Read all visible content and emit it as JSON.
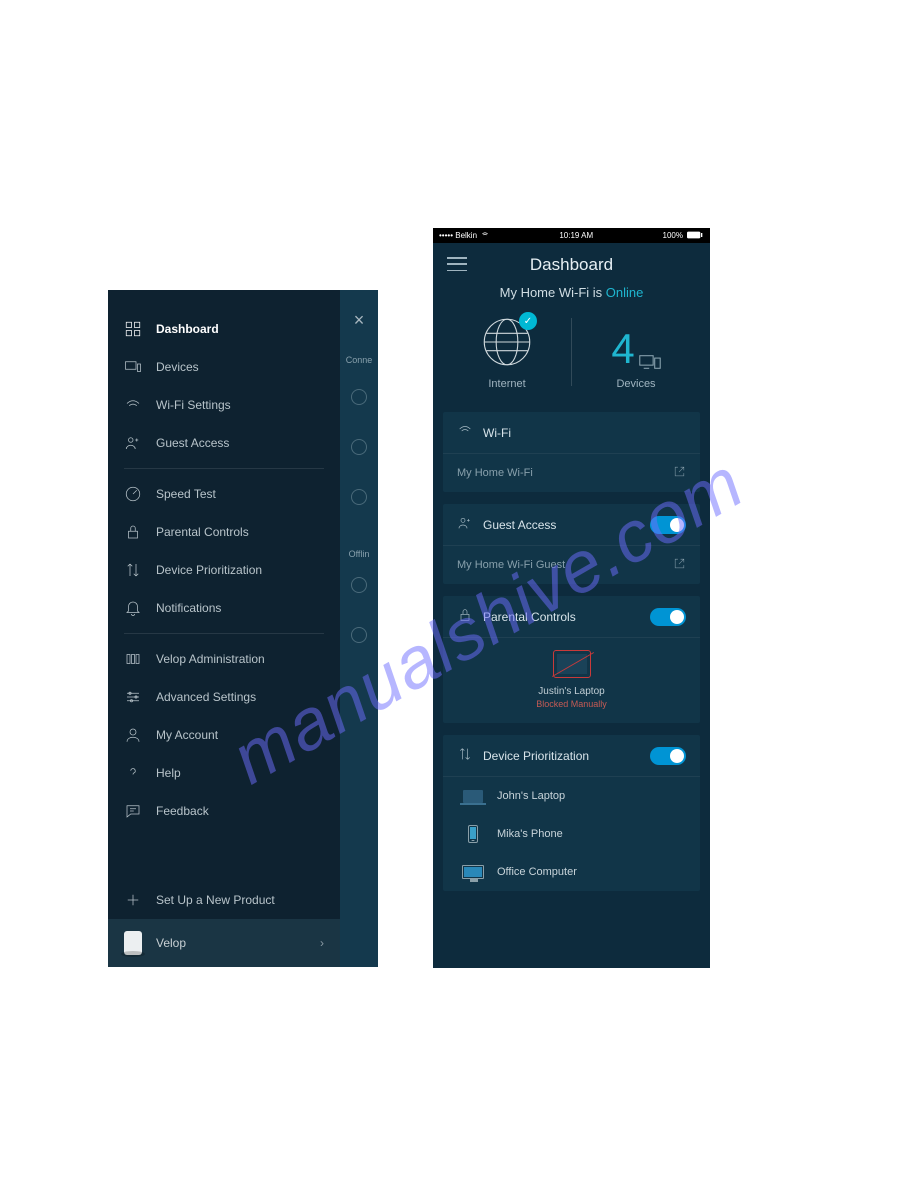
{
  "watermark": "manualshive.com",
  "left": {
    "menu": [
      {
        "label": "Dashboard",
        "active": true
      },
      {
        "label": "Devices"
      },
      {
        "label": "Wi-Fi Settings"
      },
      {
        "label": "Guest Access"
      },
      {
        "label": "Speed Test"
      },
      {
        "label": "Parental Controls"
      },
      {
        "label": "Device Prioritization"
      },
      {
        "label": "Notifications"
      },
      {
        "label": "Velop Administration"
      },
      {
        "label": "Advanced Settings"
      },
      {
        "label": "My Account"
      },
      {
        "label": "Help"
      },
      {
        "label": "Feedback"
      },
      {
        "label": "Set Up a New Product"
      }
    ],
    "footer": {
      "label": "Velop"
    },
    "sliver": {
      "close": "×",
      "connected_label": "Conne",
      "offline_label": "Offlin"
    }
  },
  "right": {
    "statusbar": {
      "carrier": "••••• Belkin",
      "time": "10:19 AM",
      "battery": "100%"
    },
    "header": {
      "title": "Dashboard"
    },
    "status_prefix": "My Home Wi-Fi is ",
    "status_value": "Online",
    "stats": {
      "internet": "Internet",
      "devices_count": "4",
      "devices_label": "Devices"
    },
    "wifi_card": {
      "title": "Wi-Fi",
      "ssid": "My Home Wi-Fi"
    },
    "guest_card": {
      "title": "Guest Access",
      "ssid": "My Home Wi-Fi Guest"
    },
    "parental_card": {
      "title": "Parental Controls",
      "blocked_name": "Justin's Laptop",
      "blocked_status": "Blocked Manually"
    },
    "priority_card": {
      "title": "Device Prioritization",
      "devices": [
        "John's Laptop",
        "Mika's Phone",
        "Office Computer"
      ]
    }
  }
}
